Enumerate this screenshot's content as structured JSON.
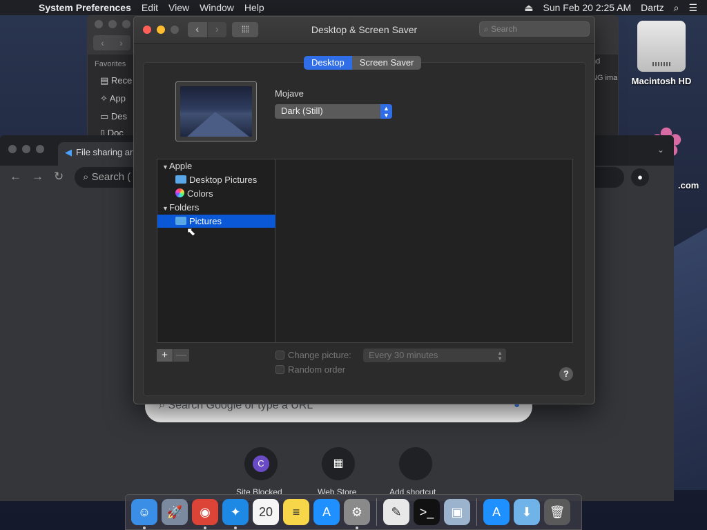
{
  "menubar": {
    "app_name": "System Preferences",
    "items": [
      "Edit",
      "View",
      "Window",
      "Help"
    ],
    "datetime": "Sun Feb 20  2:25 AM",
    "user": "Dartz"
  },
  "desktop": {
    "hd_label": "Macintosh HD",
    "partial_label": ".com"
  },
  "finder": {
    "favorites_header": "Favorites",
    "sidebar": [
      "Rece",
      "App",
      "Des",
      "Doc"
    ],
    "right_col_header": "nd",
    "right_col_text": "NG ima"
  },
  "chrome": {
    "tab_title": "File sharing ar",
    "omnibox_text": "Search (",
    "google_search_placeholder": "Search Google or type a URL",
    "shortcuts": [
      {
        "initial": "C",
        "label": "Site Blocked"
      },
      {
        "initial": "",
        "label": "Web Store"
      },
      {
        "initial": "",
        "label": "Add shortcut"
      }
    ]
  },
  "sysprefs": {
    "title": "Desktop & Screen Saver",
    "search_placeholder": "Search",
    "tabs": {
      "desktop": "Desktop",
      "screensaver": "Screen Saver"
    },
    "wallpaper_name": "Mojave",
    "appearance_popup": "Dark (Still)",
    "source_list": {
      "apple_header": "Apple",
      "desktop_pictures": "Desktop Pictures",
      "colors": "Colors",
      "folders_header": "Folders",
      "pictures": "Pictures"
    },
    "add_label": "+",
    "remove_label": "—",
    "change_picture_label": "Change picture:",
    "interval_value": "Every 30 minutes",
    "random_order_label": "Random order",
    "help_label": "?"
  },
  "dock": {
    "apps": [
      {
        "name": "finder-icon",
        "glyph": "☺",
        "color": "#3a8ee6",
        "running": true
      },
      {
        "name": "launchpad-icon",
        "glyph": "🚀",
        "color": "#7c8aa0",
        "running": false
      },
      {
        "name": "chrome-icon",
        "glyph": "◉",
        "color": "#db4437",
        "running": true
      },
      {
        "name": "safari-icon",
        "glyph": "✦",
        "color": "#1e88e5",
        "running": true
      },
      {
        "name": "calendar-icon",
        "glyph": "20",
        "color": "#f5f5f5",
        "running": false
      },
      {
        "name": "notes-icon",
        "glyph": "≡",
        "color": "#f7d64a",
        "running": false
      },
      {
        "name": "app-store-icon",
        "glyph": "A",
        "color": "#1e90ff",
        "running": false
      },
      {
        "name": "system-preferences-icon",
        "glyph": "⚙",
        "color": "#8a8a8a",
        "running": true
      },
      {
        "name": "textedit-icon",
        "glyph": "✎",
        "color": "#e8e8e8",
        "running": false
      },
      {
        "name": "terminal-icon",
        "glyph": ">_",
        "color": "#111111",
        "running": false
      },
      {
        "name": "preview-icon",
        "glyph": "▣",
        "color": "#9bb3cc",
        "running": false
      },
      {
        "name": "app-store-folder-icon",
        "glyph": "A",
        "color": "#1e90ff",
        "running": false
      },
      {
        "name": "downloads-folder-icon",
        "glyph": "⬇",
        "color": "#6fb3e8",
        "running": false
      },
      {
        "name": "trash-icon",
        "glyph": "🗑",
        "color": "#5a5a5a",
        "running": false
      }
    ]
  }
}
